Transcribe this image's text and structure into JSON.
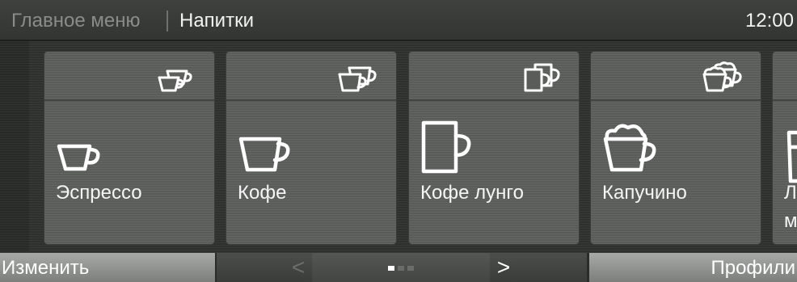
{
  "header": {
    "parent": "Главное меню",
    "current": "Напитки",
    "time": "12:00"
  },
  "tiles": [
    {
      "label": "Эспрессо",
      "label2": "",
      "cup_icon": "espresso-cup-icon",
      "double_icon": "double-espresso-cups-icon"
    },
    {
      "label": "Кофе",
      "label2": "",
      "cup_icon": "coffee-cup-icon",
      "double_icon": "double-coffee-cups-icon"
    },
    {
      "label": "Кофе лунго",
      "label2": "",
      "cup_icon": "lungo-mug-icon",
      "double_icon": "double-lungo-mugs-icon"
    },
    {
      "label": "Капучино",
      "label2": "",
      "cup_icon": "cappuccino-cup-icon",
      "double_icon": "double-cappuccino-cups-icon"
    },
    {
      "label": "Ла",
      "label2": "м",
      "cup_icon": "latte-glass-icon",
      "double_icon": ""
    }
  ],
  "footer": {
    "edit_label": "Изменить",
    "prev_label": "<",
    "next_label": ">",
    "profiles_label": "Профили",
    "pages_total": 3,
    "page_current": 1
  },
  "colors": {
    "tile": "#5a5c5a",
    "background": "#2e302e",
    "button": "#8e908e",
    "dot_active": "#ffffff",
    "dot_inactive": "#6a6c6a"
  }
}
